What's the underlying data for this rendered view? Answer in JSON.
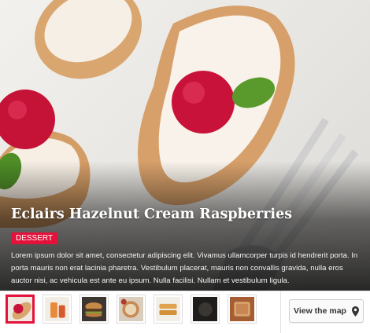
{
  "hero": {
    "image_icon": "eclair-raspberry-photo",
    "title": "Eclairs Hazelnut Cream Raspberries",
    "badge": "DESSERT",
    "description": "Lorem ipsum dolor sit amet, consectetur adipiscing elit. Vivamus ullamcorper turpis id hendrerit porta. In porta mauris non erat lacinia pharetra. Vestibulum placerat, mauris non convallis gravida, nulla eros auctor nisi, ac vehicula est ante eu ipsum. Nulla facilisi. Nullam et vestibulum ligula."
  },
  "thumbnails": [
    {
      "icon": "raspberry-eclair-thumb",
      "selected": true
    },
    {
      "icon": "drink-jar-thumb",
      "selected": false
    },
    {
      "icon": "burger-thumb",
      "selected": false
    },
    {
      "icon": "pie-thumb",
      "selected": false
    },
    {
      "icon": "pastry-thumb",
      "selected": false
    },
    {
      "icon": "dark-dish-thumb",
      "selected": false
    },
    {
      "icon": "toast-thumb",
      "selected": false
    }
  ],
  "map_button": {
    "label": "View the map",
    "icon": "map-pin-icon"
  },
  "colors": {
    "accent": "#e4123b",
    "caption_text": "#ffffff"
  }
}
